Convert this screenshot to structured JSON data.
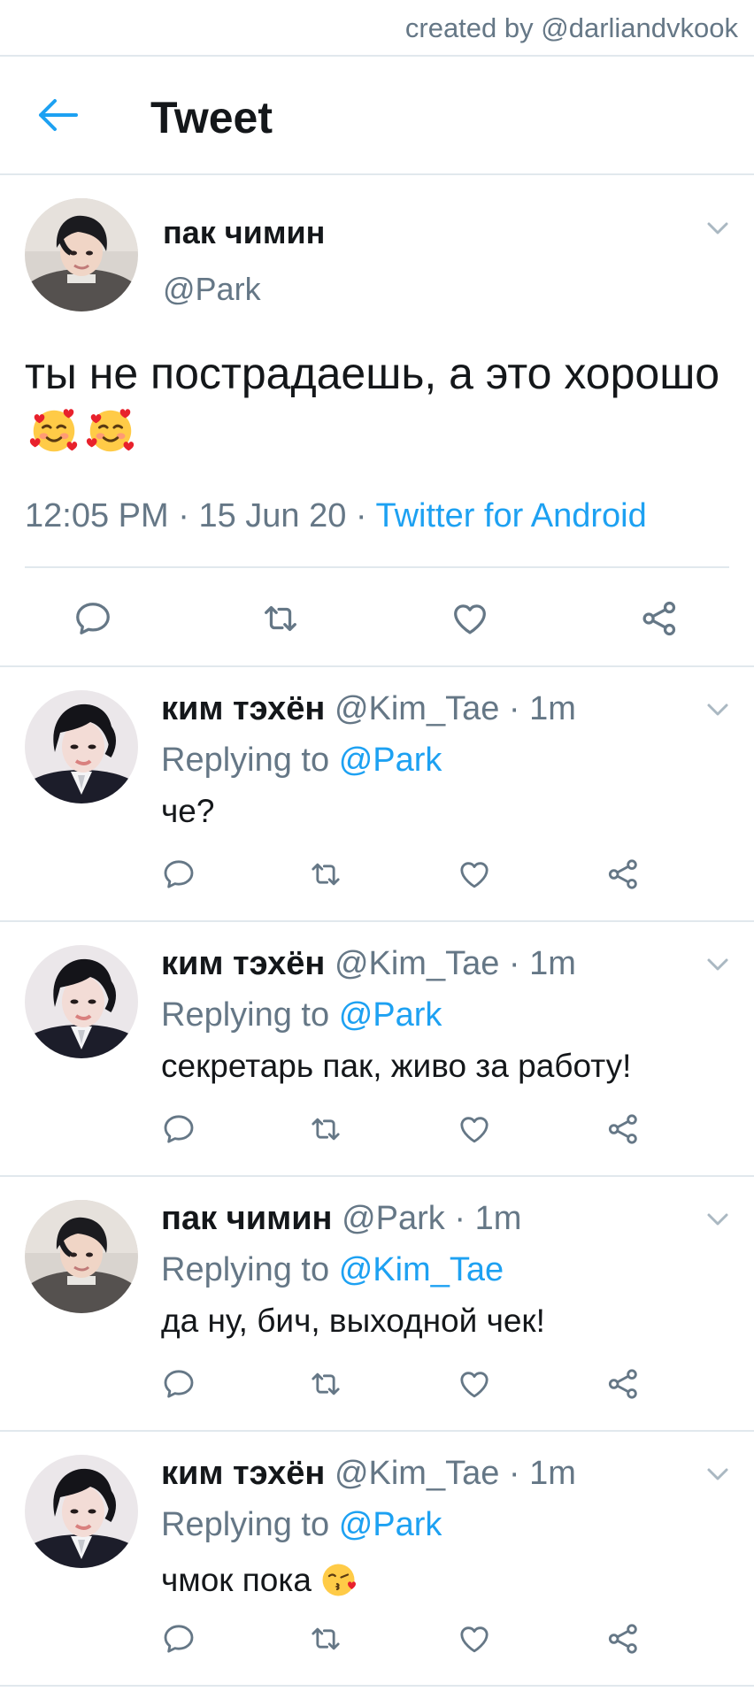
{
  "watermark": "created by @darliandvkook",
  "header": {
    "title": "Tweet"
  },
  "main_tweet": {
    "name": "пак чимин",
    "handle": "@Park",
    "text": "ты не пострадаешь, а это хорошо",
    "time": "12:05 PM",
    "sep1": " · ",
    "date": "15 Jun 20",
    "sep2": " · ",
    "source": "Twitter for Android"
  },
  "replies": [
    {
      "name": "ким тэхён",
      "handle": "@Kim_Tae",
      "dot": " · ",
      "time": "1m",
      "replying_label": "Replying to",
      "mention": "@Park",
      "text": "че?"
    },
    {
      "name": "ким тэхён",
      "handle": "@Kim_Tae",
      "dot": " · ",
      "time": "1m",
      "replying_label": "Replying to",
      "mention": "@Park",
      "text": "секретарь пак, живо за работу!"
    },
    {
      "name": "пак чимин",
      "handle": "@Park",
      "dot": " · ",
      "time": "1m",
      "replying_label": "Replying to",
      "mention": "@Kim_Tae",
      "text": "да ну, бич, выходной чек!"
    },
    {
      "name": "ким тэхён",
      "handle": "@Kim_Tae",
      "dot": " · ",
      "time": "1m",
      "replying_label": "Replying to",
      "mention": "@Park",
      "text": "чмок пока"
    }
  ],
  "icons": {
    "back": "arrow-left-icon",
    "reply": "comment-icon",
    "retweet": "retweet-icon",
    "like": "heart-icon",
    "share": "share-icon",
    "more": "chevron-down-icon",
    "emoji_main": "smiling-face-with-hearts-emoji",
    "emoji_kiss": "face-blowing-kiss-emoji"
  },
  "colors": {
    "accent": "#1da1f2",
    "secondary_text": "#657786",
    "primary_text": "#14171a",
    "divider": "#e1e8ed",
    "icon": "#657786"
  }
}
